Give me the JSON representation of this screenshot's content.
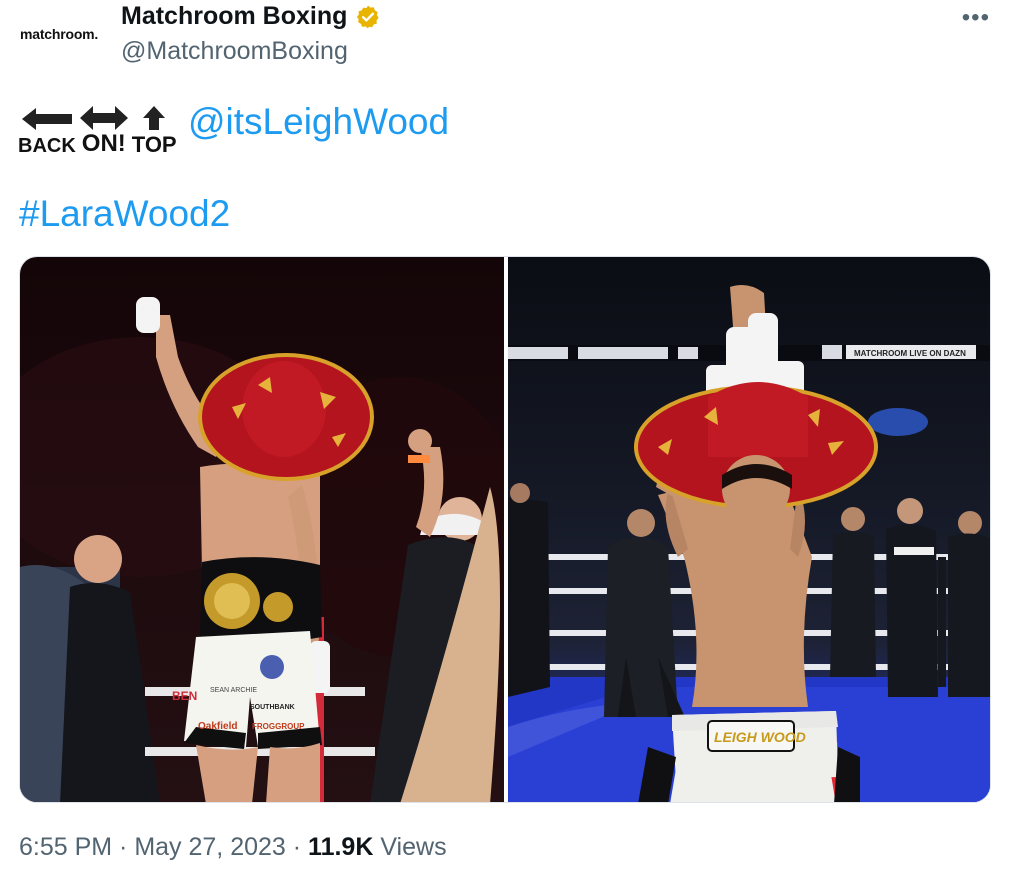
{
  "header": {
    "logo_text": "matchroom.",
    "display_name": "Matchroom Boxing",
    "handle": "@MatchroomBoxing",
    "verified_color": "#e8b400",
    "more_label": "•••"
  },
  "tweet": {
    "emoji_labels": [
      "BACK",
      "ON!",
      "TOP"
    ],
    "mention": "@itsLeighWood",
    "hashtag": "#LaraWood2"
  },
  "media": {
    "photos": [
      {
        "belt_text": [
          "BEN",
          "SEAN ARCHIE",
          "Oakfield",
          "SOUTHBANK",
          "FROGGROUP"
        ]
      },
      {
        "banner_text": "MATCHROOM LIVE ON DAZN",
        "shorts_text": "LEIGHWOOD",
        "shorts_text_display": "LEIGH WOOD"
      }
    ]
  },
  "footer": {
    "time": "6:55 PM",
    "sep": " · ",
    "date": "May 27, 2023",
    "views_count": "11.9K",
    "views_label": " Views"
  },
  "colors": {
    "link": "#1d9bf0",
    "muted": "#536471",
    "text": "#0f1419"
  }
}
